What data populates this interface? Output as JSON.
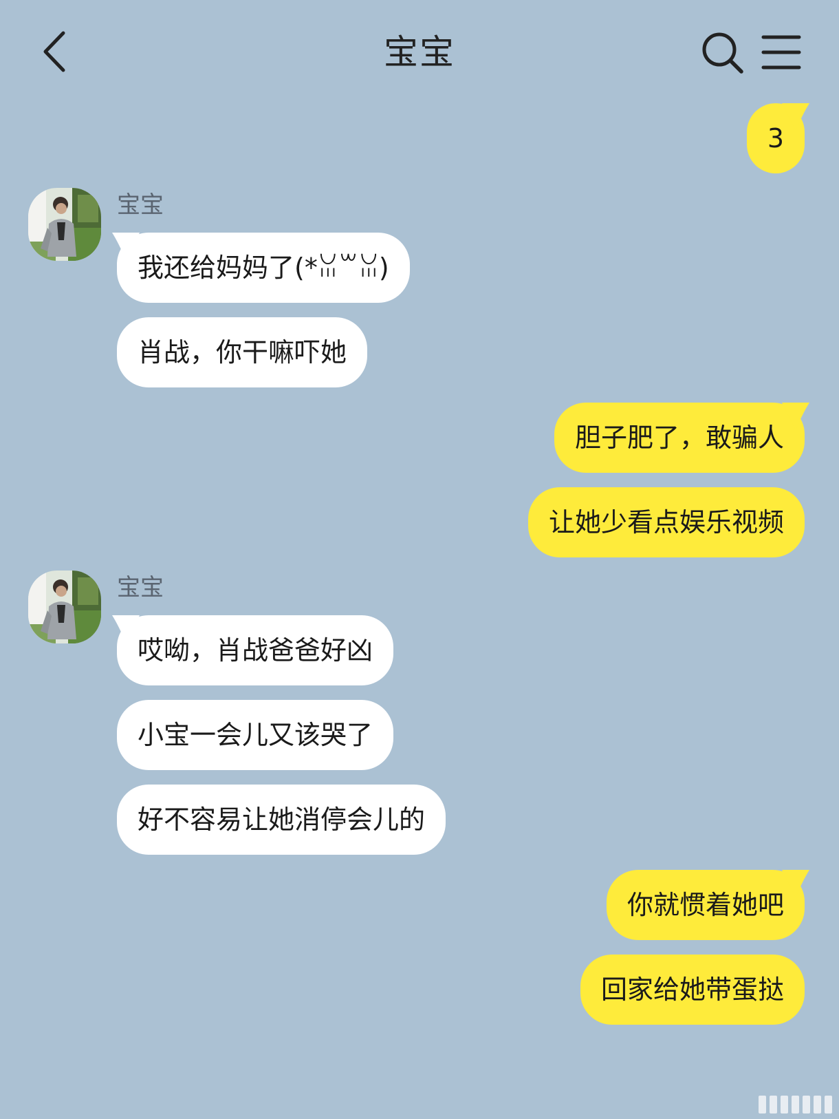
{
  "header": {
    "title": "宝宝"
  },
  "icons": {
    "back": "chevron-left-icon",
    "search": "search-icon",
    "menu": "menu-icon"
  },
  "colors": {
    "background": "#abc1d3",
    "outgoing_bubble": "#feeb3b",
    "incoming_bubble": "#ffffff"
  },
  "messages": {
    "m1": "3",
    "g1_name": "宝宝",
    "m2": "我还给妈妈了(*ꈍ꒳ꈍ)",
    "m3": "肖战，你干嘛吓她",
    "m4": "胆子肥了，敢骗人",
    "m5": "让她少看点娱乐视频",
    "g2_name": "宝宝",
    "m6": "哎呦，肖战爸爸好凶",
    "m7": "小宝一会儿又该哭了",
    "m8": "好不容易让她消停会儿的",
    "m9": "你就惯着她吧",
    "m10": "回家给她带蛋挞"
  }
}
